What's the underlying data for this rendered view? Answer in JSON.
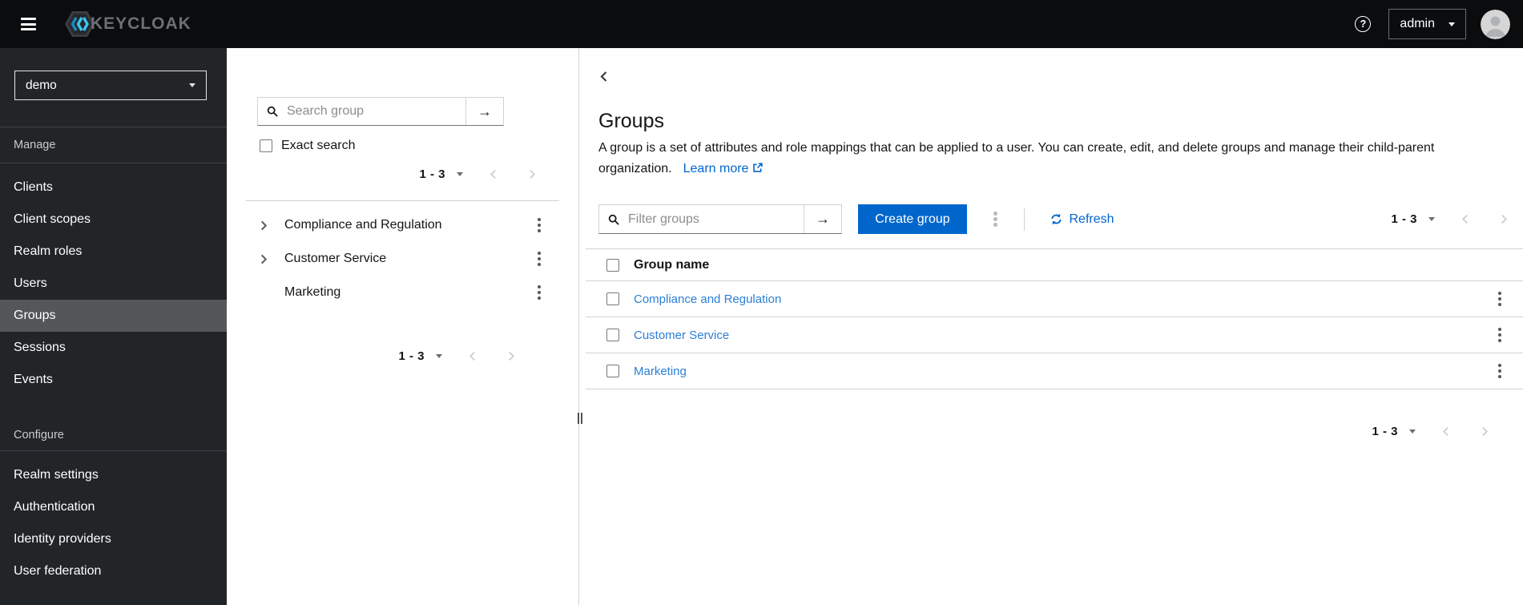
{
  "colors": {
    "accent": "#0066cc",
    "table_link": "#2b7fd6",
    "masthead_bg": "#0a0c0e",
    "sidebar_bg": "#212528",
    "sidebar_active_bg": "#53575a"
  },
  "icons": {
    "hamburger": "bars-icon",
    "help": "question-circle-icon",
    "user_caret": "caret-down-icon",
    "search": "magnifier-icon",
    "submit": "arrow-right-icon",
    "refresh": "sync-icon",
    "external_link": "external-link-icon",
    "kebab": "kebab-menu-icon"
  },
  "header": {
    "brand": "KEYCLOAK",
    "help_glyph": "?",
    "user": "admin"
  },
  "sidebar": {
    "realm": "demo",
    "sections": [
      {
        "label": "Manage",
        "items": [
          {
            "label": "Clients"
          },
          {
            "label": "Client scopes"
          },
          {
            "label": "Realm roles"
          },
          {
            "label": "Users"
          },
          {
            "label": "Groups",
            "active": true
          },
          {
            "label": "Sessions"
          },
          {
            "label": "Events"
          }
        ]
      },
      {
        "label": "Configure",
        "items": [
          {
            "label": "Realm settings"
          },
          {
            "label": "Authentication"
          },
          {
            "label": "Identity providers"
          },
          {
            "label": "User federation"
          }
        ]
      }
    ]
  },
  "tree": {
    "search_placeholder": "Search group",
    "submit_glyph": "→",
    "exact_search_label": "Exact search",
    "top_pagination": "1 - 3",
    "items": [
      {
        "label": "Compliance and Regulation",
        "expandable": true
      },
      {
        "label": "Customer Service",
        "expandable": true
      },
      {
        "label": "Marketing",
        "expandable": false
      }
    ],
    "bottom_pagination": "1 - 3"
  },
  "main": {
    "title": "Groups",
    "description": "A group is a set of attributes and role mappings that can be applied to a user. You can create, edit, and delete groups and manage their child-parent organization.",
    "learn_more_label": "Learn more",
    "toolbar": {
      "filter_placeholder": "Filter groups",
      "submit_glyph": "→",
      "create_label": "Create group",
      "refresh_label": "Refresh",
      "pagination": "1 - 3"
    },
    "table": {
      "columns": [
        "Group name"
      ],
      "rows": [
        {
          "name": "Compliance and Regulation"
        },
        {
          "name": "Customer Service"
        },
        {
          "name": "Marketing"
        }
      ]
    },
    "bottom_pagination": "1 - 3"
  }
}
